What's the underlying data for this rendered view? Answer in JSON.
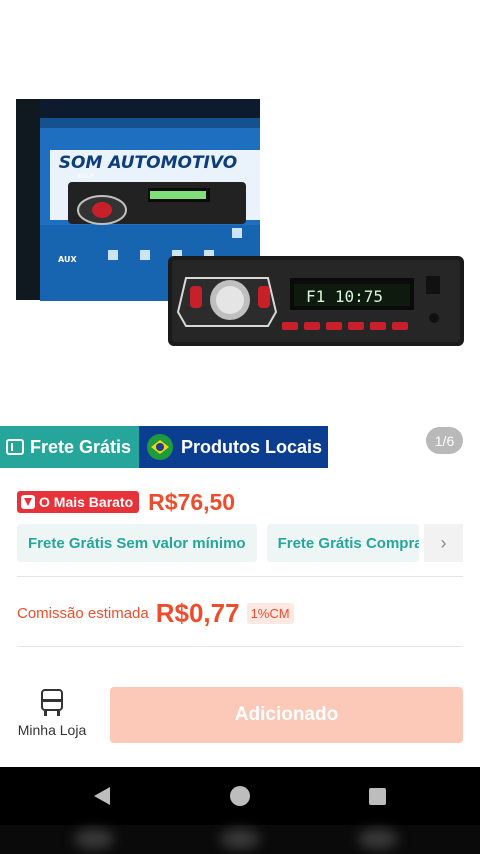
{
  "product": {
    "image_alt": "Rádio automotivo Knup",
    "box_text": "SOM AUTOMOTIVO",
    "box_brand": "KNUP",
    "box_aux": "AUX",
    "display_text": "F1 10:75"
  },
  "banners": {
    "free_shipping": "Frete Grátis",
    "local_products": "Produtos Locais"
  },
  "gallery": {
    "pager": "1/6"
  },
  "pricing": {
    "cheapest_label": "O Mais Barato",
    "price": "R$76,50"
  },
  "shipping_chips": [
    "Frete Grátis Sem valor mínimo",
    "Frete Grátis Compra"
  ],
  "commission": {
    "label": "Comissão estimada",
    "value": "R$0,77",
    "percent": "1%CM"
  },
  "actions": {
    "store_label": "Minha Loja",
    "add_label": "Adicionado"
  },
  "colors": {
    "accent": "#ee4d2d",
    "teal": "#26a69a",
    "navy": "#0b3d91",
    "button_disabled": "#fcc9b8"
  },
  "icons": {
    "store": "store-icon",
    "back": "back-icon",
    "home": "home-icon",
    "recent": "recent-apps-icon",
    "chevron": "chevron-right-icon"
  }
}
